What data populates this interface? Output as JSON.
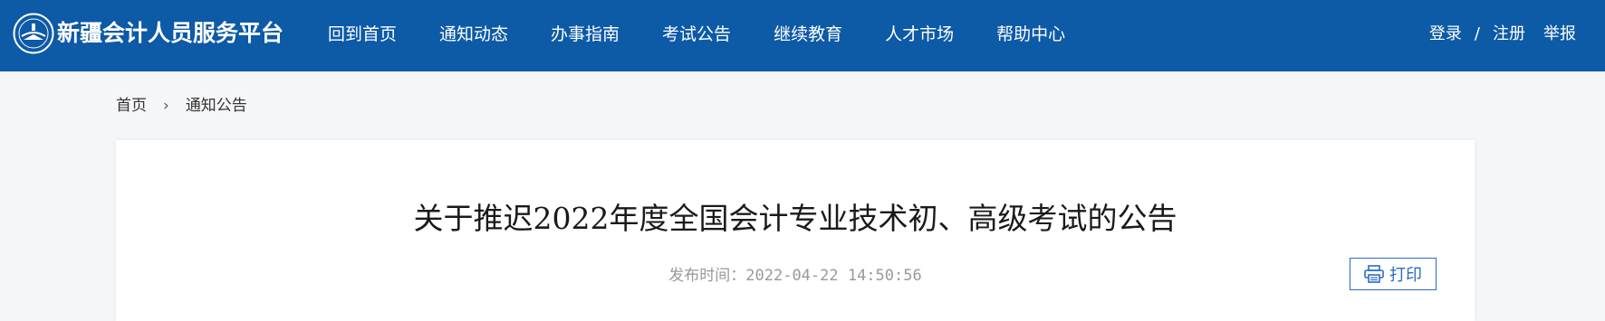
{
  "header": {
    "site_title": "新疆会计人员服务平台",
    "nav": [
      {
        "label": "回到首页"
      },
      {
        "label": "通知动态"
      },
      {
        "label": "办事指南"
      },
      {
        "label": "考试公告"
      },
      {
        "label": "继续教育"
      },
      {
        "label": "人才市场"
      },
      {
        "label": "帮助中心"
      }
    ],
    "login": "登录",
    "separator": "/",
    "register": "注册",
    "report": "举报"
  },
  "breadcrumb": {
    "home": "首页",
    "separator": "›",
    "current": "通知公告"
  },
  "article": {
    "title": "关于推迟2022年度全国会计专业技术初、高级考试的公告",
    "publish_label": "发布时间：",
    "publish_time": "2022-04-22 14:50:56",
    "print_label": "打印"
  },
  "colors": {
    "header_bg": "#0d5aa7",
    "accent": "#2d6bc6",
    "page_bg": "#f5f6f8"
  },
  "icons": {
    "logo": "accounting-emblem-icon",
    "print": "printer-icon"
  }
}
